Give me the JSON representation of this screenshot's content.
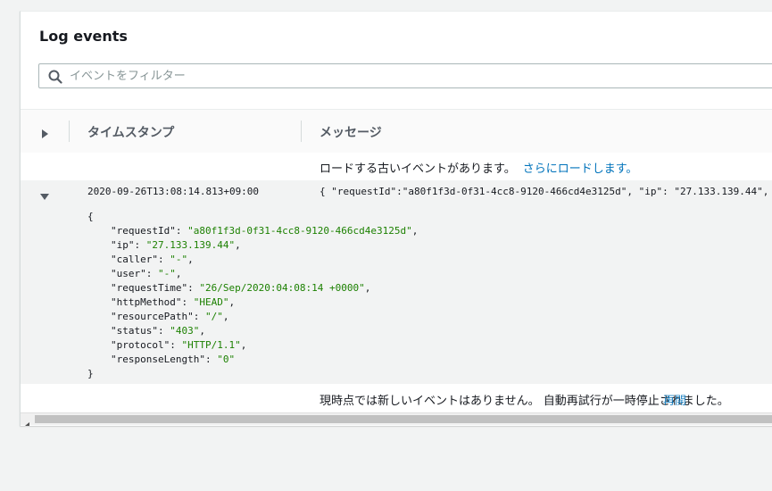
{
  "panel": {
    "title": "Log events"
  },
  "search": {
    "placeholder": "イベントをフィルター",
    "value": "",
    "icon": "search-icon"
  },
  "table": {
    "columns": [
      "タイムスタンプ",
      "メッセージ"
    ],
    "load_more": {
      "text": "ロードする古いイベントがあります。",
      "link": "さらにロードします。"
    },
    "event": {
      "timestamp": "2020-09-26T13:08:14.813+09:00",
      "message": "{ \"requestId\":\"a80f1f3d-0f31-4cc8-9120-466cd4e3125d\", \"ip\": \"27.133.139.44\",",
      "open_brace": "{",
      "close_brace": "}",
      "fields": [
        {
          "key": "\"requestId\"",
          "value": "\"a80f1f3d-0f31-4cc8-9120-466cd4e3125d\"",
          "sep": ","
        },
        {
          "key": "\"ip\"",
          "value": "\"27.133.139.44\"",
          "sep": ","
        },
        {
          "key": "\"caller\"",
          "value": "\"-\"",
          "sep": ","
        },
        {
          "key": "\"user\"",
          "value": "\"-\"",
          "sep": ","
        },
        {
          "key": "\"requestTime\"",
          "value": "\"26/Sep/2020:04:08:14 +0000\"",
          "sep": ","
        },
        {
          "key": "\"httpMethod\"",
          "value": "\"HEAD\"",
          "sep": ","
        },
        {
          "key": "\"resourcePath\"",
          "value": "\"/\"",
          "sep": ","
        },
        {
          "key": "\"status\"",
          "value": "\"403\"",
          "sep": ","
        },
        {
          "key": "\"protocol\"",
          "value": "\"HTTP/1.1\"",
          "sep": ","
        },
        {
          "key": "\"responseLength\"",
          "value": "\"0\"",
          "sep": ""
        }
      ]
    },
    "footer": {
      "text": "現時点では新しいイベントはありません。 自動再試行が一時停止されました。",
      "link": "再開"
    }
  },
  "colors": {
    "link": "#0073bb",
    "json_string": "#1d8102",
    "text": "#16191f"
  }
}
